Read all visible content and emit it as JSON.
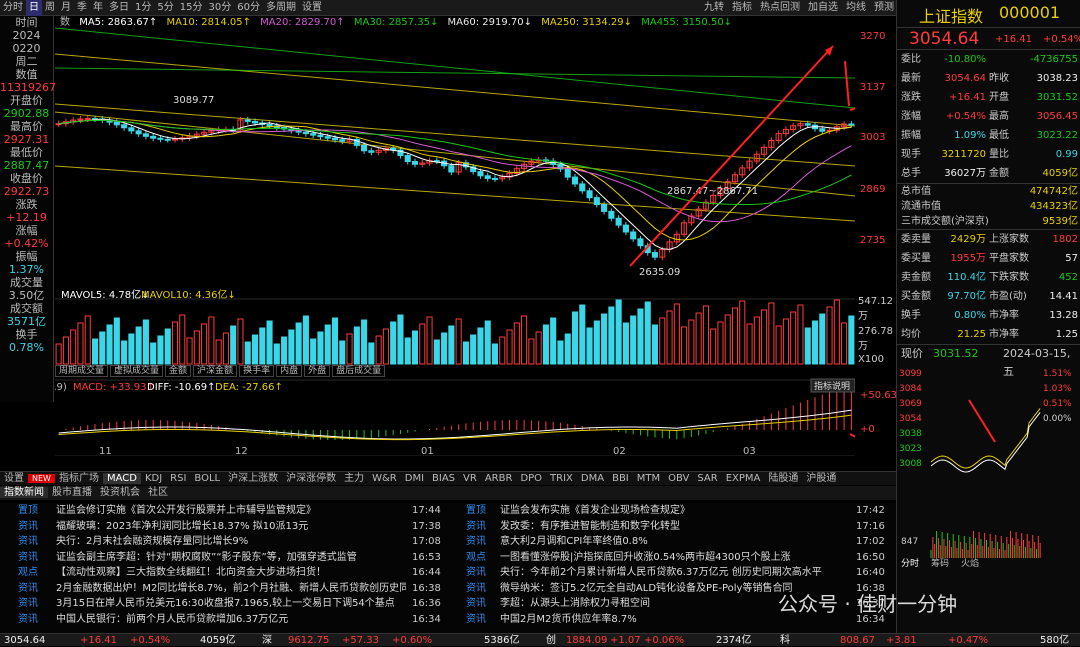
{
  "topbar": {
    "tabs": [
      "分时",
      "日",
      "周",
      "月",
      "季",
      "年",
      "多日",
      "1分",
      "5分",
      "15分",
      "30分",
      "60分",
      "多周期",
      "设置"
    ],
    "active_tab": "日",
    "right_items": [
      "九转",
      "指标",
      "热点回测",
      "加自选",
      "均线",
      "预测"
    ]
  },
  "legend": {
    "prefix": "数",
    "ma5": "MA5: 2863.67↑",
    "ma10": "MA10: 2814.05↑",
    "ma20": "MA20: 2829.70↑",
    "ma30": "MA30: 2857.35↓",
    "ma60": "MA60: 2919.70↓",
    "ma250": "MA250: 3134.29↓",
    "ma455": "MA455: 3150.50↓",
    "colors": {
      "ma5": "#ffffff",
      "ma10": "#e8d000",
      "ma20": "#d65cd6",
      "ma30": "#18c918",
      "ma60": "#e8e8e8",
      "ma250": "#e8d000",
      "ma455": "#18c918"
    }
  },
  "left_panel": {
    "time_label": "时间",
    "year": "2024",
    "date": "0220",
    "weekday": "周二",
    "value_label": "数值",
    "value": "11319267",
    "open_label": "开盘价",
    "open": "2902.88",
    "high_label": "最高价",
    "high": "2927.31",
    "low_label": "最低价",
    "low": "2887.47",
    "close_label": "收盘价",
    "close": "2922.73",
    "chg_label": "涨跌",
    "chg": "+12.19",
    "pct_label": "涨幅",
    "pct": "+0.42%",
    "amp_label": "振幅",
    "amp": "1.37%",
    "vol_label": "成交量",
    "vol": "3.50亿",
    "amt_label": "成交额",
    "amt": "3571亿",
    "turn_label": "换手",
    "turn": "0.78%"
  },
  "price_axis": [
    "3270",
    "3137",
    "3003",
    "2869",
    "2735"
  ],
  "vol_axis": [
    "547.12万",
    "276.78万",
    "X100"
  ],
  "macd_axis": [
    "+50.63",
    "+0"
  ],
  "annotations": {
    "high_mark": "3089.77",
    "low_mark": "2635.09",
    "mid_mark": "2867.47~2867.71"
  },
  "vol_legend": {
    "mavol5": "MAVOL5: 4.78亿↓",
    "mavol10": "MAVOL10: 4.36亿↓"
  },
  "sub_tabs": [
    "周期成交量",
    "虚拟成交量",
    "金额",
    "沪深金额",
    "换手率",
    "内盘",
    "外盘",
    "盘后成交量"
  ],
  "macd_legend": {
    "prefix": "5,9)",
    "macd": "MACD: +33.93↑",
    "diff": "DIFF: -10.69↑",
    "dea": "DEA: -27.66↑",
    "button": "指标说明"
  },
  "x_axis": [
    "10",
    "11",
    "12",
    "01",
    "02",
    "03"
  ],
  "indicator_tabs": [
    "设置",
    "NEW",
    "指标广场",
    "MACD",
    "KDJ",
    "RSI",
    "BOLL",
    "沪深上涨数",
    "沪深涨停数",
    "主力",
    "W&R",
    "DMI",
    "BIAS",
    "VR",
    "ARBR",
    "DPO",
    "TRIX",
    "DMA",
    "BBI",
    "MTM",
    "OBV",
    "SAR",
    "EXPMA",
    "陆股通",
    "沪股通"
  ],
  "news_tabs": [
    "指数新闻",
    "股市直播",
    "投资机会",
    "社区"
  ],
  "news_left": [
    {
      "tag": "置顶",
      "title": "证监会修订实施《首次公开发行股票并上市辅导监管规定》",
      "time": "17:44"
    },
    {
      "tag": "资讯",
      "title": "福耀玻璃：2023年净利润同比增长18.37% 拟10派13元",
      "time": "17:38"
    },
    {
      "tag": "资讯",
      "title": "央行：2月末社会融资规模存量同比增长9%",
      "time": "17:08"
    },
    {
      "tag": "资讯",
      "title": "证监会副主席李超：针对“期权腐败”“影子股东”等，加强穿透式监管",
      "time": "16:53"
    },
    {
      "tag": "观点",
      "title": "【流动性观察】三大指数全线翻红！北向资金大步进场扫货！",
      "time": "16:44"
    },
    {
      "tag": "资讯",
      "title": "2月金融数据出炉！M2同比增长8.7%，前2个月社融、新增人民币贷款创历史同期",
      "time": "16:38"
    },
    {
      "tag": "资讯",
      "title": "3月15日在岸人民币兑美元16:30收盘报7.1965,较上一交易日下调54个基点",
      "time": "16:36"
    },
    {
      "tag": "资讯",
      "title": "中国人民银行：前两个月人民币贷款增加6.37万亿元",
      "time": "16:34"
    }
  ],
  "news_right": [
    {
      "tag": "置顶",
      "title": "证监会发布实施《首发企业现场检查规定》",
      "time": "17:42"
    },
    {
      "tag": "资讯",
      "title": "发改委：有序推进智能制造和数字化转型",
      "time": "17:16"
    },
    {
      "tag": "资讯",
      "title": "意大利2月调和CPI年率终值0.8%",
      "time": "17:02"
    },
    {
      "tag": "观点",
      "title": "一图看懂涨停股|沪指探底回升收涨0.54%两市超4300只个股上涨",
      "time": "16:50"
    },
    {
      "tag": "资讯",
      "title": "央行：今年前2个月累计新增人民币贷款6.37万亿元 创历史同期次高水平",
      "time": "16:40"
    },
    {
      "tag": "资讯",
      "title": "微导纳米：签订5.2亿元全自动ALD钝化设备及PE-Poly等销售合同",
      "time": "16:38"
    },
    {
      "tag": "资讯",
      "title": "李超：从源头上消除权力寻租空间",
      "time": "16:37"
    },
    {
      "tag": "资讯",
      "title": "中国2月M2货币供应年率8.7%",
      "time": "16:34"
    }
  ],
  "right_panel": {
    "title": "上证指数",
    "code": "000001",
    "price": "3054.64",
    "chg": "+16.41",
    "pct": "+0.54%",
    "rows": [
      {
        "l": "委比",
        "v": "-10.80%",
        "vc": "grn",
        "l2": "",
        "v2": "-4736755",
        "v2c": "grn"
      },
      {
        "l": "最新",
        "v": "3054.64",
        "vc": "red",
        "l2": "昨收",
        "v2": "3038.23",
        "v2c": "wht"
      },
      {
        "l": "涨跌",
        "v": "+16.41",
        "vc": "red",
        "l2": "开盘",
        "v2": "3031.52",
        "v2c": "grn"
      },
      {
        "l": "涨幅",
        "v": "+0.54%",
        "vc": "red",
        "l2": "最高",
        "v2": "3056.45",
        "v2c": "red"
      },
      {
        "l": "振幅",
        "v": "1.09%",
        "vc": "cyan",
        "l2": "最低",
        "v2": "3023.22",
        "v2c": "grn"
      },
      {
        "l": "现手",
        "v": "3211720",
        "vc": "yel",
        "l2": "量比",
        "v2": "0.99",
        "v2c": "cyan"
      },
      {
        "l": "总手",
        "v": "36027万",
        "vc": "wht",
        "l2": "金额",
        "v2": "4059亿",
        "v2c": "yel"
      }
    ],
    "caps": [
      {
        "l": "总市值",
        "v": "474742亿"
      },
      {
        "l": "流通市值",
        "v": "434323亿"
      },
      {
        "l": "三市成交额(沪深京)",
        "v": "9539亿"
      }
    ],
    "rows2": [
      {
        "l": "委卖量",
        "v": "2429万",
        "vc": "yel",
        "l2": "上涨家数",
        "v2": "1802",
        "v2c": "red"
      },
      {
        "l": "委买量",
        "v": "1955万",
        "vc": "red",
        "l2": "平盘家数",
        "v2": "57",
        "v2c": "wht"
      },
      {
        "l": "卖金额",
        "v": "110.4亿",
        "vc": "cyan",
        "l2": "下跌家数",
        "v2": "452",
        "v2c": "grn"
      },
      {
        "l": "买金额",
        "v": "97.70亿",
        "vc": "cyan",
        "l2": "市盈(动)",
        "v2": "14.41",
        "v2c": "wht"
      },
      {
        "l": "换手",
        "v": "0.80%",
        "vc": "cyan",
        "l2": "市净率",
        "v2": "13.28",
        "v2c": "wht"
      },
      {
        "l": "均价",
        "v": "21.25",
        "vc": "yel",
        "l2": "市净率",
        "v2": "1.25",
        "v2c": "wht"
      }
    ],
    "mini": {
      "label": "现价",
      "price": "3031.52",
      "date": "2024-03-15,五",
      "y_left": [
        "3099",
        "3084",
        "3069",
        "3054",
        "3038",
        "3023",
        "3008"
      ],
      "y_right": [
        "1.51%",
        "1.03%",
        "0.51%",
        "0.00%"
      ],
      "vol_label": "847",
      "tabs": [
        "分时",
        "筹码",
        "火焰"
      ]
    }
  },
  "status_bar": [
    {
      "t": "3054.64",
      "c": "wht"
    },
    {
      "t": "+16.41",
      "c": "red"
    },
    {
      "t": "+0.54%",
      "c": "red"
    },
    {
      "t": "4059亿",
      "c": "wht"
    },
    {
      "t": "深",
      "c": "wht"
    },
    {
      "t": "9612.75",
      "c": "red"
    },
    {
      "t": "+57.33",
      "c": "red"
    },
    {
      "t": "+0.60%",
      "c": "red"
    },
    {
      "t": "5386亿",
      "c": "wht"
    },
    {
      "t": "创",
      "c": "wht"
    },
    {
      "t": "1884.09",
      "c": "red"
    },
    {
      "t": "+1.07",
      "c": "red"
    },
    {
      "t": "+0.06%",
      "c": "red"
    },
    {
      "t": "2374亿",
      "c": "wht"
    },
    {
      "t": "科",
      "c": "wht"
    },
    {
      "t": "808.67",
      "c": "red"
    },
    {
      "t": "+3.81",
      "c": "red"
    },
    {
      "t": "+0.47%",
      "c": "red"
    },
    {
      "t": "580亿",
      "c": "wht"
    }
  ],
  "watermark": "公众号 · 佳财一分钟"
}
